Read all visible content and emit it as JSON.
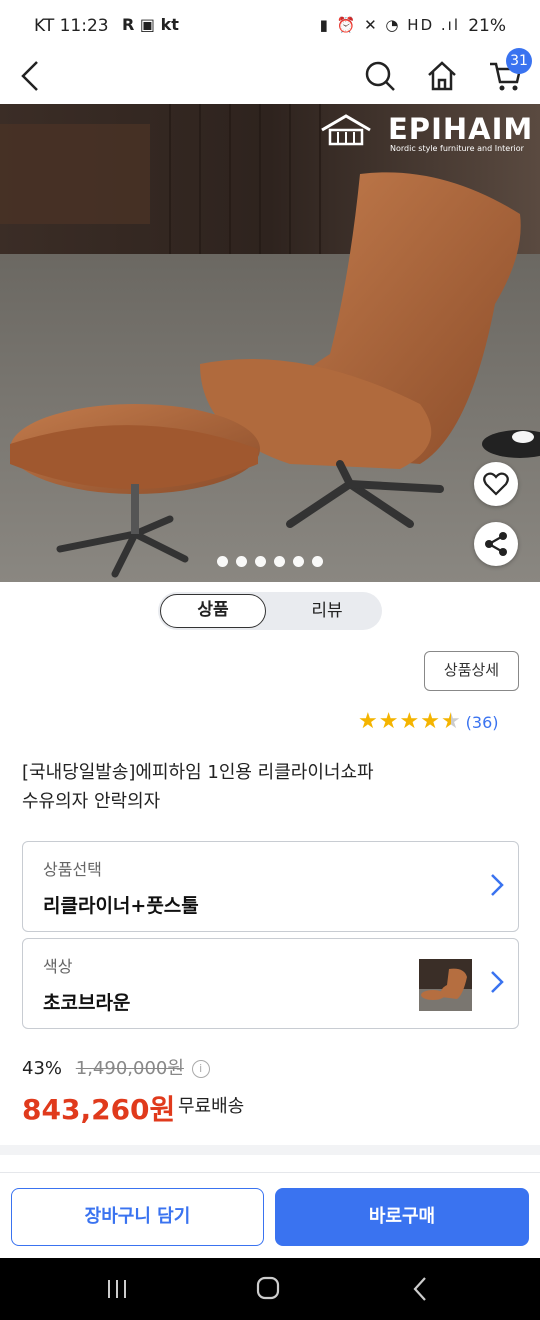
{
  "status_bar": {
    "time": "KT 11:23",
    "battery": "21%"
  },
  "header": {
    "cart_count": "31"
  },
  "brand": {
    "name": "EPIHAIM",
    "tagline": "Nordic style furniture and Interior"
  },
  "tabs": [
    {
      "label": "상품"
    },
    {
      "label": "리뷰"
    }
  ],
  "detail_button": "상품상세",
  "rating": {
    "count": "(36)"
  },
  "product": {
    "title_line1": "[국내당일발송]에피하임 1인용 리클라이너쇼파",
    "title_line2": "수유의자 안락의자"
  },
  "options": [
    {
      "label": "상품선택",
      "value": "리클라이너+풋스툴"
    },
    {
      "label": "색상",
      "value": "초코브라운"
    }
  ],
  "price": {
    "discount": "43%",
    "original": "1,490,000원",
    "final": "843,260원",
    "shipping": "무료배송"
  },
  "actions": {
    "cart": "장바구니 담기",
    "buy": "바로구매"
  },
  "colors": {
    "accent": "#3a73f0",
    "price": "#e03a1c",
    "star": "#f4b400"
  }
}
